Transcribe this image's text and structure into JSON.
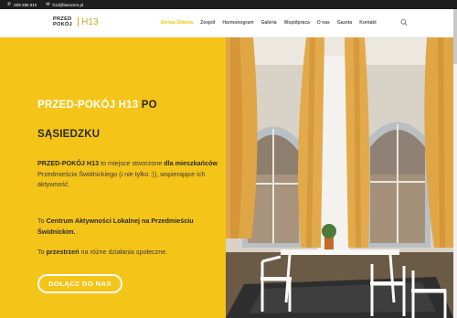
{
  "topbar": {
    "phone": "509 286 910",
    "email": "h13@lanszem.pl",
    "phone_icon": "phone-icon",
    "email_icon": "envelope-icon"
  },
  "header": {
    "logo_line1": "PRZED",
    "logo_line2": "POKÓJ",
    "logo_h13": "H13",
    "nav": [
      {
        "label": "Strona Główna",
        "active": true
      },
      {
        "label": "Zespół"
      },
      {
        "label": "Harmonogram"
      },
      {
        "label": "Galeria"
      },
      {
        "label": "Współpraca"
      },
      {
        "label": "O nas"
      },
      {
        "label": "Gazeta"
      },
      {
        "label": "Kontakt"
      }
    ],
    "search_icon": "search-icon"
  },
  "hero": {
    "title_part1": "PRZED-POKÓJ H13 ",
    "title_part2": "PO",
    "title_line2": "SĄSIEDZKU",
    "p1": {
      "b1": "PRZED-POKÓJ H13",
      "t1": " to miejsce stworzone ",
      "b2": "dla mieszkańców",
      "t2": " Przedmieścia Świdnickiego (i nie tylko :)), wspierające ich aktywność."
    },
    "p2": {
      "t1": "To ",
      "b1": "Centrum Aktywności Lokalnej na Przedmieściu Świdnickim."
    },
    "p3": {
      "t1": "To ",
      "b1": "przestrzeń",
      "t2": " na różne działania społeczne."
    },
    "button": "DOŁĄCZ DO NAS",
    "photo_alt": "room-photo"
  },
  "colors": {
    "accent": "#f5c419",
    "nav_active": "#f1c40f",
    "topbar": "#1e1e1e"
  }
}
